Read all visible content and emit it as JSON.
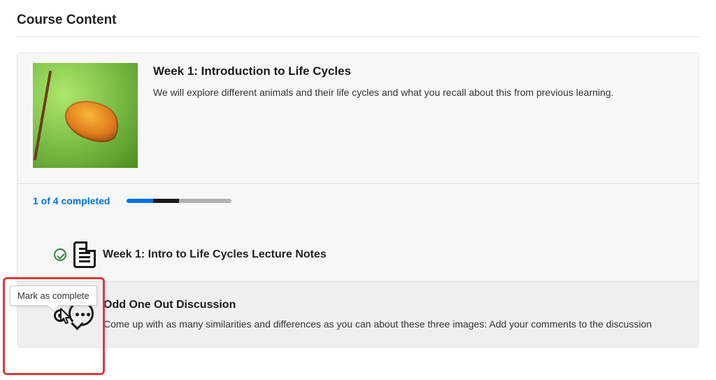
{
  "page": {
    "title": "Course Content"
  },
  "intro": {
    "title": "Week 1: Introduction to Life Cycles",
    "description": "We will explore different animals and their life cycles and what you recall about this from previous learning."
  },
  "progress": {
    "label": "1 of 4 completed",
    "completed": 1,
    "total": 4
  },
  "items": [
    {
      "title": "Week 1: Intro to Life Cycles Lecture Notes",
      "type": "document",
      "completed": true
    },
    {
      "title": "Odd One Out Discussion",
      "type": "discussion",
      "description": "Come up with as many similarities and differences as you can about these three images: Add your comments to the discussion",
      "completed": false
    }
  ],
  "tooltip": {
    "text": "Mark as complete"
  }
}
